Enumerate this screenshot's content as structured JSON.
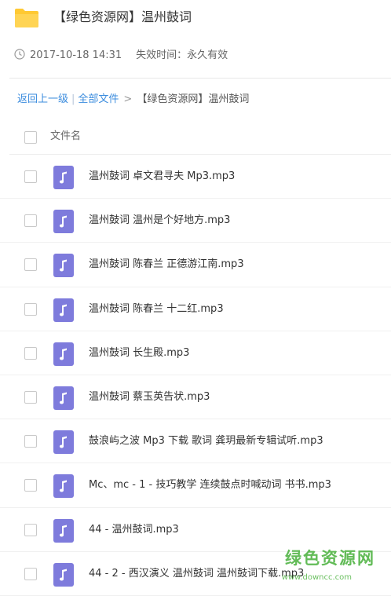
{
  "header": {
    "title": "【绿色资源网】温州鼓词"
  },
  "meta": {
    "date": "2017-10-18 14:31",
    "expire": "失效时间：永久有效"
  },
  "breadcrumb": {
    "back": "返回上一级",
    "sep": "|",
    "all": "全部文件",
    "arrow": ">",
    "current": "【绿色资源网】温州鼓词"
  },
  "table": {
    "column_name": "文件名"
  },
  "files": [
    {
      "name": "温州鼓词 卓文君寻夫 Mp3.mp3"
    },
    {
      "name": "温州鼓词 温州是个好地方.mp3"
    },
    {
      "name": "温州鼓词 陈春兰 正德游江南.mp3"
    },
    {
      "name": "温州鼓词 陈春兰 十二红.mp3"
    },
    {
      "name": "温州鼓词 长生殿.mp3"
    },
    {
      "name": "温州鼓词 蔡玉英告状.mp3"
    },
    {
      "name": "鼓浪屿之波 Mp3 下载 歌词 龚玥最新专辑试听.mp3"
    },
    {
      "name": "Mc、mc - 1 - 技巧教学 连续鼓点时喊动词 书书.mp3"
    },
    {
      "name": "44 - 温州鼓词.mp3"
    },
    {
      "name": "44 - 2 - 西汉演义 温州鼓词 温州鼓词下载.mp3"
    }
  ],
  "watermark": {
    "text": "绿色资源网",
    "url": "www.downcc.com"
  },
  "colors": {
    "folder": "#ffc933",
    "music_icon": "#7e7bdc",
    "link": "#3b8cde",
    "watermark": "#47b03a"
  },
  "icons": {
    "folder": "folder-icon",
    "clock": "clock-icon",
    "file": "music-file-icon"
  }
}
